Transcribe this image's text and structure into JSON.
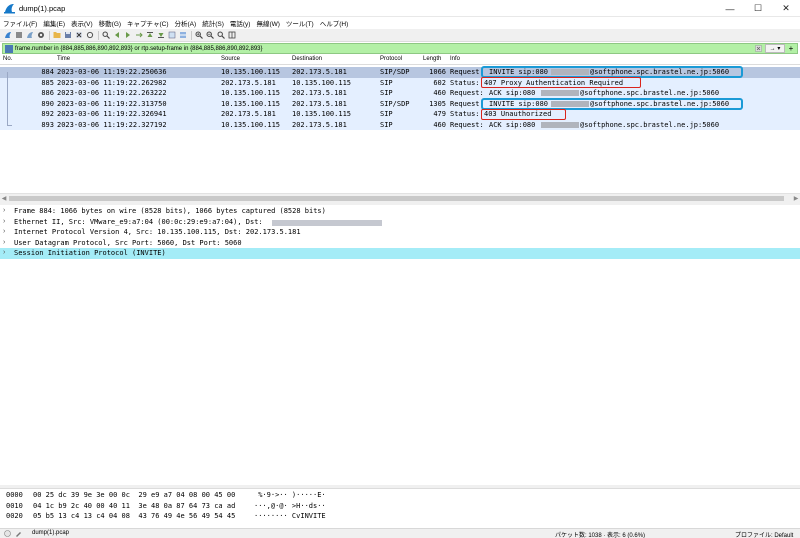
{
  "window": {
    "title": "dump(1).pcap",
    "minimize": "—",
    "maximize": "☐",
    "close": "✕"
  },
  "menu": [
    "ファイル(F)",
    "編集(E)",
    "表示(V)",
    "移動(G)",
    "キャプチャ(C)",
    "分析(A)",
    "統計(S)",
    "電話(y)",
    "無線(W)",
    "ツール(T)",
    "ヘルプ(H)"
  ],
  "filter": {
    "expression": "frame.number in {884,885,886,890,892,893} or rtp.setup-frame in {884,885,886,890,892,893}",
    "apply_label": "→ ▾",
    "add_label": "+"
  },
  "packet_list": {
    "columns": {
      "no": "No.",
      "time": "Time",
      "source": "Source",
      "destination": "Destination",
      "protocol": "Protocol",
      "length": "Length",
      "info": "Info"
    },
    "rows": [
      {
        "no": "884",
        "time": "2023-03-06 11:19:22.250636",
        "source": "10.135.100.115",
        "destination": "202.173.5.181",
        "protocol": "SIP/SDP",
        "length": "1066",
        "info_prefix": "Request:",
        "info_a": "INVITE sip:080",
        "info_b": "@softphone.spc.brastel.ne.jp:5060"
      },
      {
        "no": "885",
        "time": "2023-03-06 11:19:22.262982",
        "source": "202.173.5.181",
        "destination": "10.135.100.115",
        "protocol": "SIP",
        "length": "602",
        "info_prefix": "Status:",
        "info_a": "407 Proxy Authentication Required",
        "info_b": ""
      },
      {
        "no": "886",
        "time": "2023-03-06 11:19:22.263222",
        "source": "10.135.100.115",
        "destination": "202.173.5.181",
        "protocol": "SIP",
        "length": "460",
        "info_prefix": "Request:",
        "info_a": "ACK sip:080",
        "info_b": "@softphone.spc.brastel.ne.jp:5060"
      },
      {
        "no": "890",
        "time": "2023-03-06 11:19:22.313750",
        "source": "10.135.100.115",
        "destination": "202.173.5.181",
        "protocol": "SIP/SDP",
        "length": "1305",
        "info_prefix": "Request:",
        "info_a": "INVITE sip:080",
        "info_b": "@softphone.spc.brastel.ne.jp:5060"
      },
      {
        "no": "892",
        "time": "2023-03-06 11:19:22.326941",
        "source": "202.173.5.181",
        "destination": "10.135.100.115",
        "protocol": "SIP",
        "length": "479",
        "info_prefix": "Status:",
        "info_a": "403 Unauthorized",
        "info_b": ""
      },
      {
        "no": "893",
        "time": "2023-03-06 11:19:22.327192",
        "source": "10.135.100.115",
        "destination": "202.173.5.181",
        "protocol": "SIP",
        "length": "460",
        "info_prefix": "Request:",
        "info_a": "ACK sip:080",
        "info_b": "@softphone.spc.brastel.ne.jp:5060"
      }
    ]
  },
  "details": [
    {
      "text": "Frame 884: 1066 bytes on wire (8528 bits), 1066 bytes captured (8528 bits)",
      "tail": ""
    },
    {
      "text": "Ethernet II, Src: VMware_e9:a7:04 (00:0c:29:e9:a7:04), Dst:",
      "tail": ""
    },
    {
      "text": "Internet Protocol Version 4, Src: 10.135.100.115, Dst: 202.173.5.181",
      "tail": ""
    },
    {
      "text": "User Datagram Protocol, Src Port: 5060, Dst Port: 5060",
      "tail": ""
    },
    {
      "text": "Session Initiation Protocol (INVITE)",
      "tail": ""
    }
  ],
  "bytes": [
    {
      "offset": "0000",
      "hex": "00 25 dc 39 9e 3e 00 0c  29 e9 a7 04 08 00 45 00",
      "ascii": " %·9·>·· )·····E·"
    },
    {
      "offset": "0010",
      "hex": "04 1c b9 2c 40 00 40 11  3e 48 0a 87 64 73 ca ad",
      "ascii": "···,@·@· >H··ds··"
    },
    {
      "offset": "0020",
      "hex": "05 b5 13 c4 13 c4 04 08  43 76 49 4e 56 49 54 45",
      "ascii": "········ CvINVITE"
    }
  ],
  "status": {
    "file": "dump(1).pcap",
    "packets": "パケット数: 1038 · 表示: 6 (0.6%)",
    "profile": "プロファイル: Default"
  },
  "colors": {
    "filter_bg": "#b3f0a6",
    "selected_detail": "#a4ecf7",
    "highlight_blue": "#1b9ad6",
    "highlight_red": "#d9241c"
  }
}
